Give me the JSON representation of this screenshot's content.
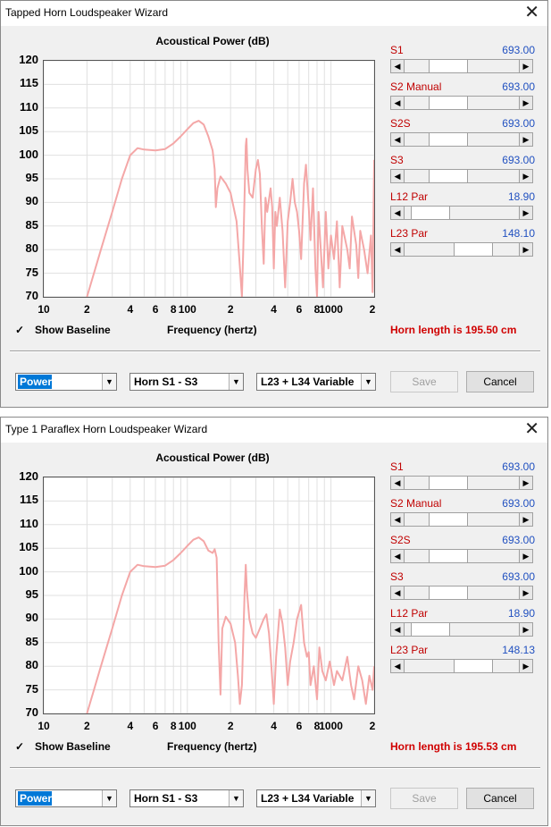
{
  "colors": {
    "curve": "#f4a7a7",
    "grid": "#e0e0e0",
    "param_label": "#c00000",
    "param_value": "#2050c0",
    "horn_length": "#d00000",
    "selected": "#0078d7"
  },
  "icons": {
    "close": "close-icon",
    "check": "checkmark-icon",
    "dropdown": "chevron-down-icon",
    "scroll_left": "arrow-left-icon",
    "scroll_right": "arrow-right-icon"
  },
  "windows": [
    {
      "title": "Tapped Horn Loudspeaker Wizard",
      "close_glyph": "✕",
      "show_baseline": {
        "label": "Show Baseline",
        "checked": true,
        "check_glyph": "✓"
      },
      "x_axis_label": "Frequency (hertz)",
      "horn_length": "Horn length is 195.50 cm",
      "params": [
        {
          "label": "S1",
          "value": "693.00",
          "position": 0.32
        },
        {
          "label": "S2  Manual",
          "value": "693.00",
          "position": 0.32
        },
        {
          "label": "S2S",
          "value": "693.00",
          "position": 0.32
        },
        {
          "label": "S3",
          "value": "693.00",
          "position": 0.32
        },
        {
          "label": "L12  Par",
          "value": "18.90",
          "position": 0.08
        },
        {
          "label": "L23  Par",
          "value": "148.10",
          "position": 0.66
        }
      ],
      "combos": {
        "mode": "Power",
        "horn": "Horn S1 - S3",
        "variable": "L23 + L34 Variable"
      },
      "buttons": {
        "save": "Save",
        "cancel": "Cancel"
      }
    },
    {
      "title": "Type 1 Paraflex Horn Loudspeaker Wizard",
      "close_glyph": "✕",
      "show_baseline": {
        "label": "Show Baseline",
        "checked": true,
        "check_glyph": "✓"
      },
      "x_axis_label": "Frequency (hertz)",
      "horn_length": "Horn length is 195.53 cm",
      "params": [
        {
          "label": "S1",
          "value": "693.00",
          "position": 0.32
        },
        {
          "label": "S2  Manual",
          "value": "693.00",
          "position": 0.32
        },
        {
          "label": "S2S",
          "value": "693.00",
          "position": 0.32
        },
        {
          "label": "S3",
          "value": "693.00",
          "position": 0.32
        },
        {
          "label": "L12  Par",
          "value": "18.90",
          "position": 0.08
        },
        {
          "label": "L23  Par",
          "value": "148.13",
          "position": 0.66
        }
      ],
      "combos": {
        "mode": "Power",
        "horn": "Horn S1 - S3",
        "variable": "L23 + L34 Variable"
      },
      "buttons": {
        "save": "Save",
        "cancel": "Cancel"
      }
    }
  ],
  "chart_data": [
    {
      "type": "line",
      "title": "Acoustical Power (dB)",
      "xlabel": "Frequency (hertz)",
      "ylabel": "",
      "x_scale": "log",
      "xlim": [
        10,
        2000
      ],
      "ylim": [
        70,
        120
      ],
      "grid": true,
      "y_ticks": [
        "120",
        "115",
        "110",
        "105",
        "100",
        "95",
        "90",
        "85",
        "80",
        "75",
        "70"
      ],
      "x_ticks": [
        {
          "v": 10,
          "label": "10"
        },
        {
          "v": 20,
          "label": "2"
        },
        {
          "v": 40,
          "label": "4"
        },
        {
          "v": 60,
          "label": "6"
        },
        {
          "v": 80,
          "label": "8"
        },
        {
          "v": 100,
          "label": "100"
        },
        {
          "v": 200,
          "label": "2"
        },
        {
          "v": 400,
          "label": "4"
        },
        {
          "v": 600,
          "label": "6"
        },
        {
          "v": 800,
          "label": "8"
        },
        {
          "v": 1000,
          "label": "1000"
        },
        {
          "v": 2000,
          "label": "2"
        }
      ],
      "series": [
        {
          "points": [
            [
              20,
              70
            ],
            [
              25,
              80
            ],
            [
              30,
              88
            ],
            [
              35,
              95
            ],
            [
              40,
              100
            ],
            [
              45,
              101.5
            ],
            [
              50,
              101.2
            ],
            [
              60,
              101
            ],
            [
              70,
              101.3
            ],
            [
              80,
              102.5
            ],
            [
              90,
              104
            ],
            [
              100,
              105.5
            ],
            [
              110,
              106.8
            ],
            [
              120,
              107.3
            ],
            [
              130,
              106.5
            ],
            [
              140,
              104
            ],
            [
              150,
              101
            ],
            [
              155,
              97
            ],
            [
              158,
              89
            ],
            [
              162,
              93
            ],
            [
              170,
              95.5
            ],
            [
              185,
              94
            ],
            [
              200,
              92
            ],
            [
              220,
              86
            ],
            [
              230,
              78
            ],
            [
              240,
              70
            ],
            [
              245,
              80
            ],
            [
              255,
              102
            ],
            [
              258,
              103.5
            ],
            [
              262,
              97
            ],
            [
              270,
              92
            ],
            [
              285,
              91
            ],
            [
              300,
              97
            ],
            [
              310,
              99
            ],
            [
              320,
              96
            ],
            [
              330,
              85
            ],
            [
              340,
              77
            ],
            [
              350,
              91
            ],
            [
              360,
              88
            ],
            [
              380,
              93
            ],
            [
              390,
              89
            ],
            [
              400,
              76
            ],
            [
              410,
              88
            ],
            [
              420,
              85
            ],
            [
              440,
              91
            ],
            [
              460,
              84
            ],
            [
              480,
              72
            ],
            [
              500,
              86
            ],
            [
              520,
              90
            ],
            [
              540,
              95
            ],
            [
              560,
              90
            ],
            [
              580,
              88
            ],
            [
              600,
              84
            ],
            [
              620,
              78
            ],
            [
              650,
              94
            ],
            [
              670,
              98
            ],
            [
              700,
              89
            ],
            [
              720,
              82
            ],
            [
              750,
              93
            ],
            [
              780,
              76
            ],
            [
              800,
              70
            ],
            [
              820,
              88
            ],
            [
              850,
              80
            ],
            [
              880,
              72
            ],
            [
              920,
              88
            ],
            [
              960,
              76
            ],
            [
              1000,
              83
            ],
            [
              1050,
              78
            ],
            [
              1100,
              86
            ],
            [
              1150,
              72
            ],
            [
              1200,
              85
            ],
            [
              1300,
              80
            ],
            [
              1350,
              76
            ],
            [
              1400,
              87
            ],
            [
              1500,
              81
            ],
            [
              1550,
              74
            ],
            [
              1600,
              84
            ],
            [
              1700,
              80
            ],
            [
              1800,
              75
            ],
            [
              1900,
              83
            ],
            [
              1950,
              71
            ],
            [
              2000,
              99
            ]
          ]
        }
      ]
    },
    {
      "type": "line",
      "title": "Acoustical Power (dB)",
      "xlabel": "Frequency (hertz)",
      "ylabel": "",
      "x_scale": "log",
      "xlim": [
        10,
        2000
      ],
      "ylim": [
        70,
        120
      ],
      "grid": true,
      "y_ticks": [
        "120",
        "115",
        "110",
        "105",
        "100",
        "95",
        "90",
        "85",
        "80",
        "75",
        "70"
      ],
      "x_ticks": [
        {
          "v": 10,
          "label": "10"
        },
        {
          "v": 20,
          "label": "2"
        },
        {
          "v": 40,
          "label": "4"
        },
        {
          "v": 60,
          "label": "6"
        },
        {
          "v": 80,
          "label": "8"
        },
        {
          "v": 100,
          "label": "100"
        },
        {
          "v": 200,
          "label": "2"
        },
        {
          "v": 400,
          "label": "4"
        },
        {
          "v": 600,
          "label": "6"
        },
        {
          "v": 800,
          "label": "8"
        },
        {
          "v": 1000,
          "label": "1000"
        },
        {
          "v": 2000,
          "label": "2"
        }
      ],
      "series": [
        {
          "points": [
            [
              20,
              70
            ],
            [
              25,
              80
            ],
            [
              30,
              88
            ],
            [
              35,
              95
            ],
            [
              40,
              100
            ],
            [
              45,
              101.5
            ],
            [
              50,
              101.2
            ],
            [
              60,
              101
            ],
            [
              70,
              101.3
            ],
            [
              80,
              102.5
            ],
            [
              90,
              104
            ],
            [
              100,
              105.5
            ],
            [
              110,
              106.8
            ],
            [
              120,
              107.3
            ],
            [
              130,
              106.5
            ],
            [
              140,
              104.5
            ],
            [
              150,
              104
            ],
            [
              155,
              104.8
            ],
            [
              160,
              103
            ],
            [
              165,
              85
            ],
            [
              170,
              74
            ],
            [
              175,
              88
            ],
            [
              185,
              90.5
            ],
            [
              200,
              89
            ],
            [
              215,
              85
            ],
            [
              225,
              78
            ],
            [
              232,
              72
            ],
            [
              240,
              76
            ],
            [
              250,
              95
            ],
            [
              255,
              101.5
            ],
            [
              260,
              96
            ],
            [
              270,
              90
            ],
            [
              285,
              87
            ],
            [
              300,
              86
            ],
            [
              320,
              88
            ],
            [
              340,
              90
            ],
            [
              355,
              91
            ],
            [
              370,
              87
            ],
            [
              385,
              80
            ],
            [
              400,
              72
            ],
            [
              415,
              82
            ],
            [
              440,
              92
            ],
            [
              460,
              89
            ],
            [
              480,
              84
            ],
            [
              500,
              76
            ],
            [
              520,
              81
            ],
            [
              550,
              85
            ],
            [
              580,
              90
            ],
            [
              620,
              93
            ],
            [
              650,
              85
            ],
            [
              680,
              82
            ],
            [
              700,
              83
            ],
            [
              720,
              76
            ],
            [
              760,
              80
            ],
            [
              800,
              73
            ],
            [
              830,
              84
            ],
            [
              870,
              79
            ],
            [
              920,
              77
            ],
            [
              980,
              81
            ],
            [
              1050,
              76
            ],
            [
              1100,
              79
            ],
            [
              1200,
              77
            ],
            [
              1300,
              82
            ],
            [
              1380,
              76
            ],
            [
              1450,
              73
            ],
            [
              1550,
              80
            ],
            [
              1650,
              77
            ],
            [
              1750,
              72
            ],
            [
              1850,
              78
            ],
            [
              1950,
              75
            ],
            [
              2000,
              80
            ]
          ]
        }
      ]
    }
  ]
}
